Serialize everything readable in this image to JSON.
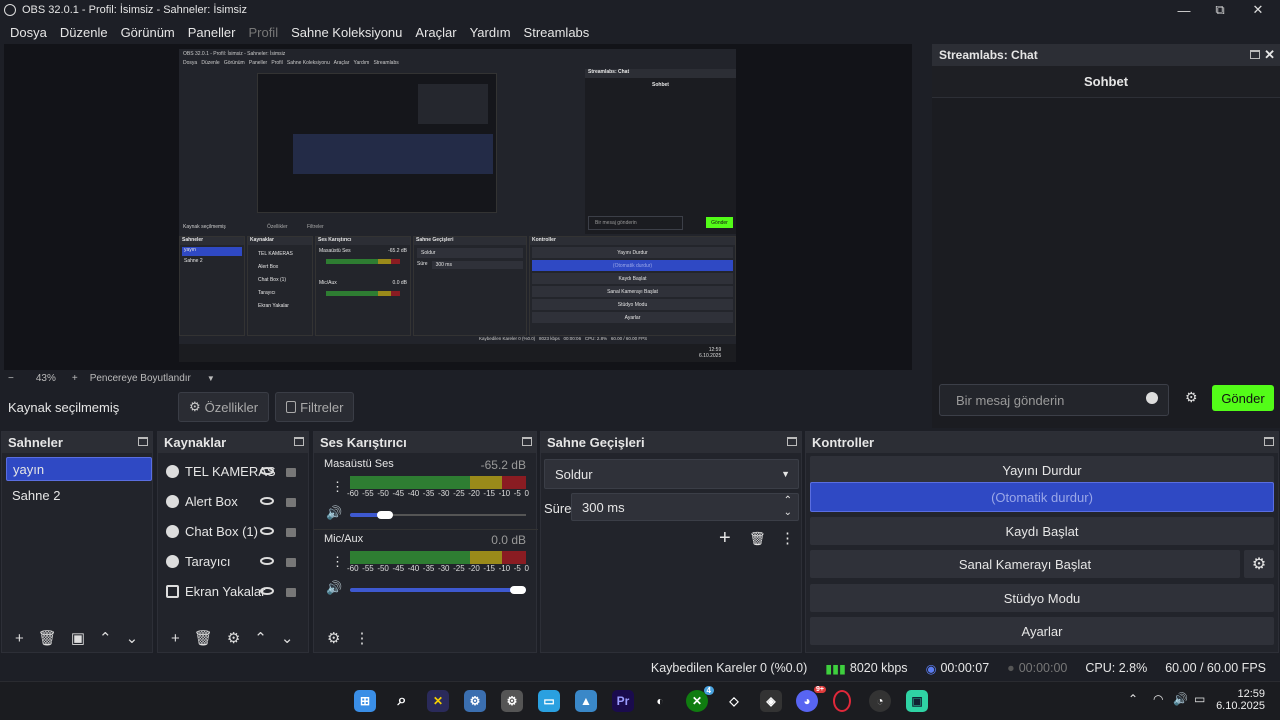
{
  "window": {
    "title": "OBS 32.0.1 - Profil: İsimsiz - Sahneler: İsimsiz",
    "minimize": "—",
    "maximize": "⧉",
    "close": "✕"
  },
  "menu": [
    "Dosya",
    "Düzenle",
    "Görünüm",
    "Paneller",
    "Profil",
    "Sahne Koleksiyonu",
    "Araçlar",
    "Yardım",
    "Streamlabs"
  ],
  "preview": {
    "zoom": "43%",
    "zoom_minus": "−",
    "zoom_plus": "+",
    "resize_label": "Pencereye Boyutlandır",
    "nested_mirror": {
      "title": "OBS 32.0.1 - Profil: İsimsiz - Sahneler: İsimsiz",
      "menu": "Dosya   Düzenle   Görünüm   Paneller   Profil   Sahne Koleksiyonu   Araçlar   Yardım   Streamlabs",
      "chat_title": "Streamlabs: Chat",
      "chat_sub": "Sohbet",
      "chat_input": "Bir mesaj gönderin",
      "chat_send": "Gönder",
      "src_label": "Kaynak seçilmemiş",
      "props": "Özellikler",
      "filters": "Filtreler",
      "docks": [
        "Sahneler",
        "Kaynaklar",
        "Ses Karıştırıcı",
        "Sahne Geçişleri",
        "Kontroller"
      ],
      "scenes": [
        "yayın",
        "Sahne 2"
      ],
      "sources": [
        "TEL KAMERAS",
        "Alert Box",
        "Chat Box (1)",
        "Tarayıcı",
        "Ekran Yakalar"
      ],
      "mixer": [
        "Masaüstü Ses",
        "Mic/Aux"
      ],
      "mixer_db": [
        "-65.2 dB",
        "0.0 dB"
      ],
      "transition": "Soldur",
      "duration_label": "Süre",
      "duration": "300 ms",
      "controls": [
        "Yayını Durdur",
        "(Otomatik durdur)",
        "Kaydı Başlat",
        "Sanal Kamerayı Başlat",
        "Stüdyo Modu",
        "Ayarlar"
      ],
      "status": "Kaybedilen Kareler 0 (%0.0)   8023 kbps   00:00:06   CPU: 2.8%   60.00 / 60.00 FPS",
      "time": "12:59",
      "date": "6.10.2025"
    }
  },
  "source_bar": {
    "label": "Kaynak seçilmemiş",
    "properties": "Özellikler",
    "filters": "Filtreler"
  },
  "chat": {
    "title": "Streamlabs: Chat",
    "subtitle": "Sohbet",
    "placeholder": "Bir mesaj gönderin",
    "send": "Gönder",
    "accent": "#53fc18"
  },
  "scenes": {
    "title": "Sahneler",
    "items": [
      "yayın",
      "Sahne 2"
    ],
    "selected": 0
  },
  "sources": {
    "title": "Kaynaklar",
    "items": [
      {
        "label": "TEL KAMERAS",
        "icon": "globe-icon"
      },
      {
        "label": "Alert Box",
        "icon": "globe-icon"
      },
      {
        "label": "Chat Box (1)",
        "icon": "globe-icon"
      },
      {
        "label": "Tarayıcı",
        "icon": "globe-icon"
      },
      {
        "label": "Ekran Yakalar",
        "icon": "monitor-icon"
      }
    ]
  },
  "mixer": {
    "title": "Ses Karıştırıcı",
    "channels": [
      {
        "name": "Masaüstü Ses",
        "db": "-65.2 dB",
        "volume": 0.2
      },
      {
        "name": "Mic/Aux",
        "db": "0.0 dB",
        "volume": 1.0
      }
    ],
    "ticks": [
      "-60",
      "-55",
      "-50",
      "-45",
      "-40",
      "-35",
      "-30",
      "-25",
      "-20",
      "-15",
      "-10",
      "-5",
      "0"
    ]
  },
  "transitions": {
    "title": "Sahne Geçişleri",
    "selected": "Soldur",
    "duration_label": "Süre",
    "duration": "300 ms"
  },
  "controls": {
    "title": "Kontroller",
    "buttons": [
      "Yayını Durdur",
      "(Otomatik durdur)",
      "Kaydı Başlat",
      "Sanal Kamerayı Başlat",
      "Stüdyo Modu",
      "Ayarlar"
    ],
    "active_color": "#2f49c4"
  },
  "status": {
    "dropped": "Kaybedilen Kareler 0 (%0.0)",
    "bitrate": "8020 kbps",
    "stream_time": "00:00:07",
    "rec_time": "00:00:00",
    "cpu": "CPU: 2.8%",
    "fps": "60.00 / 60.00 FPS"
  },
  "taskbar": {
    "time": "12:59",
    "date": "6.10.2025",
    "xbox_badge": "4",
    "discord_badge": "9+"
  }
}
